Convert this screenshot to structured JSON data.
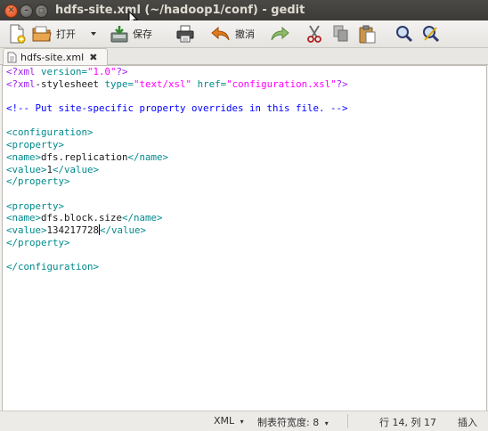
{
  "window": {
    "title": "hdfs-site.xml (~/hadoop1/conf) - gedit"
  },
  "toolbar": {
    "open_label": "打开",
    "save_label": "保存",
    "undo_label": "撤消"
  },
  "tab": {
    "label": "hdfs-site.xml",
    "close_glyph": "✖"
  },
  "editor": {
    "lines": [
      [
        {
          "t": "<?xml ",
          "c": "pi"
        },
        {
          "t": "version=",
          "c": "attr"
        },
        {
          "t": "\"1.0\"",
          "c": "str"
        },
        {
          "t": "?>",
          "c": "pi"
        }
      ],
      [
        {
          "t": "<?xml",
          "c": "pi"
        },
        {
          "t": "-stylesheet ",
          "c": "plain"
        },
        {
          "t": "type=",
          "c": "attr"
        },
        {
          "t": "\"text/xsl\"",
          "c": "str"
        },
        {
          "t": " ",
          "c": "plain"
        },
        {
          "t": "href=",
          "c": "attr"
        },
        {
          "t": "\"configuration.xsl\"",
          "c": "str"
        },
        {
          "t": "?>",
          "c": "pi"
        }
      ],
      [],
      [
        {
          "t": "<!-- Put site-specific property overrides in this file. -->",
          "c": "cmt"
        }
      ],
      [],
      [
        {
          "t": "<configuration>",
          "c": "tag"
        }
      ],
      [
        {
          "t": "<property>",
          "c": "tag"
        }
      ],
      [
        {
          "t": "<name>",
          "c": "tag"
        },
        {
          "t": "dfs.replication",
          "c": "plain"
        },
        {
          "t": "</name>",
          "c": "tag"
        }
      ],
      [
        {
          "t": "<value>",
          "c": "tag"
        },
        {
          "t": "1",
          "c": "plain"
        },
        {
          "t": "</value>",
          "c": "tag"
        }
      ],
      [
        {
          "t": "</property>",
          "c": "tag"
        }
      ],
      [],
      [
        {
          "t": "<property>",
          "c": "tag"
        }
      ],
      [
        {
          "t": "<name>",
          "c": "tag"
        },
        {
          "t": "dfs.block.size",
          "c": "plain"
        },
        {
          "t": "</name>",
          "c": "tag"
        }
      ],
      [
        {
          "t": "<value>",
          "c": "tag"
        },
        {
          "t": "134217728",
          "c": "plain"
        },
        {
          "t": "|",
          "c": "caret"
        },
        {
          "t": "</value>",
          "c": "tag"
        }
      ],
      [
        {
          "t": "</property>",
          "c": "tag"
        }
      ],
      [],
      [
        {
          "t": "</configuration>",
          "c": "tag"
        }
      ]
    ]
  },
  "status": {
    "language": "XML",
    "tab_width": "制表符宽度: 8",
    "position": "行 14, 列 17",
    "mode": "插入"
  },
  "colors": {
    "processing_instruction": "#a020f0",
    "attribute": "#008a8c",
    "string": "#ff00ff",
    "comment": "#0000ff",
    "tag": "#008a8c"
  }
}
